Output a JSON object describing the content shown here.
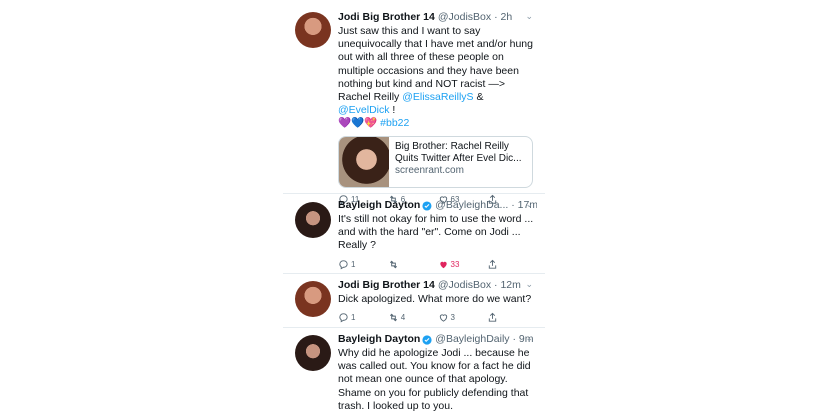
{
  "tweets": [
    {
      "name": "Jodi Big Brother 14",
      "handle": "@JodisBox",
      "time": "· 2h",
      "text_before": "Just saw this and I want to say unequivocally that I have met and/or hung out with all three of these people on multiple occasions and they have been nothing but kind and NOT racist —> Rachel Reilly ",
      "mention1": "@ElissaReillyS",
      "amp": " & ",
      "mention2": "@EvelDick",
      "bang": " !",
      "emoji": "💜💙💖",
      "hashtag": " #bb22",
      "card": {
        "title": "Big Brother: Rachel Reilly Quits Twitter After Evel Dic...",
        "domain": "screenrant.com"
      },
      "replies": "11",
      "retweets": "6",
      "likes": "63"
    },
    {
      "name": "Bayleigh Dayton",
      "handle": "@BayleighDa... · 17m",
      "text": "It's still not okay for him to use the word ... and with the hard \"er\". Come on Jodi ... Really ?",
      "replies": "1",
      "retweets": "",
      "likes": "33"
    },
    {
      "name": "Jodi Big Brother 14",
      "handle": "@JodisBox · 12m",
      "text": "Dick apologized. What more do we want?",
      "replies": "1",
      "retweets": "4",
      "likes": "3"
    },
    {
      "name": "Bayleigh Dayton",
      "handle": "@BayleighDaily · 9m",
      "text": "Why did he apologize Jodi ... because he was called out. You know for a fact he did not mean one ounce of that apology. Shame on you for publicly defending that trash. I looked up to you."
    }
  ],
  "colors": {
    "link": "#1da1f2",
    "like": "#e0245e",
    "muted": "#536471"
  },
  "icons": [
    "reply-icon",
    "retweet-icon",
    "like-icon",
    "share-icon",
    "verified-icon",
    "chevron-down-icon"
  ]
}
